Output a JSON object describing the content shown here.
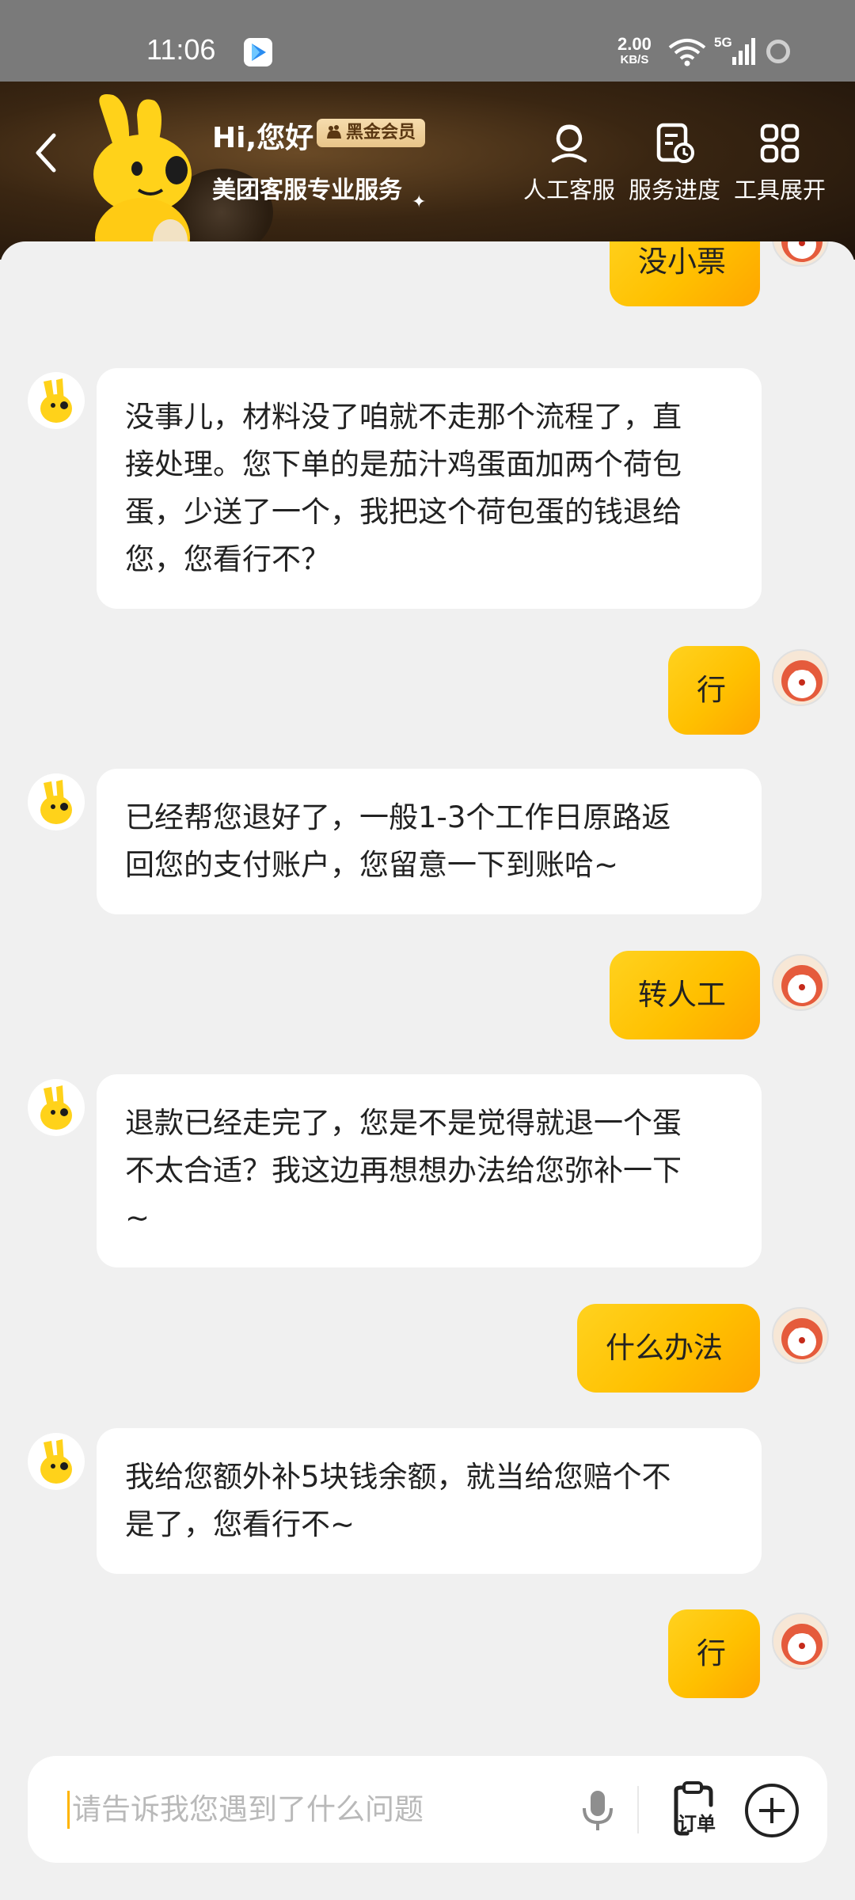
{
  "status_bar": {
    "time": "11:06",
    "net_speed_value": "2.00",
    "net_speed_unit": "KB/S",
    "network_type": "5G",
    "icons": [
      "app-icon",
      "wifi-icon",
      "cellular-signal-icon",
      "loading-icon"
    ]
  },
  "header": {
    "greeting": "Hi,您好",
    "vip_badge": "黑金会员",
    "subtitle": "美团客服专业服务",
    "tools": [
      {
        "label": "人工客服",
        "icon": "agent-headset-icon"
      },
      {
        "label": "服务进度",
        "icon": "service-progress-icon"
      },
      {
        "label": "工具展开",
        "icon": "grid-tools-icon"
      }
    ]
  },
  "messages": [
    {
      "from": "user",
      "text": "没小票"
    },
    {
      "from": "bot",
      "lines": [
        "没事儿，材料没了咱就不走那个流程了，直",
        "接处理。您下单的是茄汁鸡蛋面加两个荷包",
        "蛋，少送了一个，我把这个荷包蛋的钱退给",
        "您，您看行不？"
      ]
    },
    {
      "from": "user",
      "text": "行"
    },
    {
      "from": "bot",
      "lines": [
        "已经帮您退好了，一般1-3个工作日原路返",
        "回您的支付账户，您留意一下到账哈~"
      ]
    },
    {
      "from": "user",
      "text": "转人工"
    },
    {
      "from": "bot",
      "lines": [
        "退款已经走完了，您是不是觉得就退一个蛋",
        "不太合适？我这边再想想办法给您弥补一下",
        "~"
      ]
    },
    {
      "from": "user",
      "text": "什么办法"
    },
    {
      "from": "bot",
      "lines": [
        "我给您额外补5块钱余额，就当给您赔个不",
        "是了，您看行不~"
      ]
    },
    {
      "from": "user",
      "text": "行"
    }
  ],
  "input": {
    "placeholder": "请告诉我您遇到了什么问题",
    "order_button": "订单",
    "icons": [
      "microphone-icon",
      "order-clipboard-icon",
      "plus-icon"
    ]
  },
  "colors": {
    "accent_yellow": "#ffc300",
    "header_dark": "#2a1b0d",
    "chat_bg": "#f0f0f0"
  }
}
